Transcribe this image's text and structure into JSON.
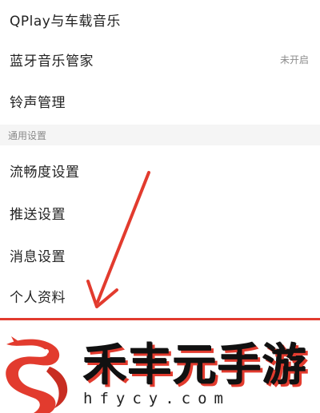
{
  "settings": {
    "items_top": [
      {
        "label": "QPlay与车载音乐",
        "value": ""
      },
      {
        "label": "蓝牙音乐管家",
        "value": "未开启"
      },
      {
        "label": "铃声管理",
        "value": ""
      }
    ],
    "section_title": "通用设置",
    "items_general": [
      {
        "label": "流畅度设置"
      },
      {
        "label": "推送设置"
      },
      {
        "label": "消息设置"
      },
      {
        "label": "个人资料"
      }
    ]
  },
  "watermark": {
    "brand_name": "禾丰元手游",
    "url": "hfycy.com",
    "accent_color": "#e23b2e"
  },
  "annotation": {
    "arrow_color": "#e23b2e"
  }
}
